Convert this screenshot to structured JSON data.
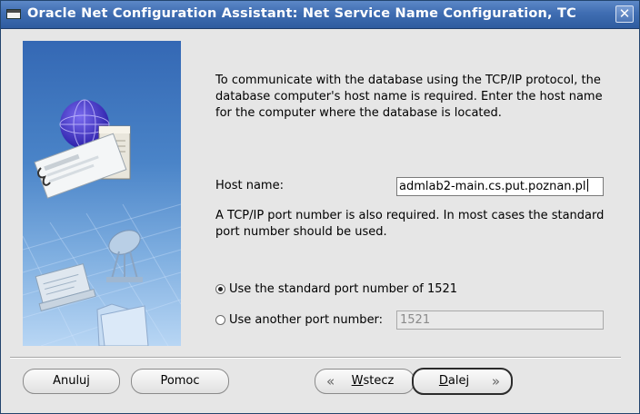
{
  "window": {
    "title": "Oracle Net Configuration Assistant: Net Service Name Configuration,  TC",
    "close_glyph": "✕"
  },
  "content": {
    "intro": "To communicate with the database using the TCP/IP protocol, the database computer's host name is required. Enter the host name for the computer where the database is located.",
    "host_label": "Host name:",
    "host_value": "admlab2-main.cs.put.poznan.pl",
    "port_note": "A TCP/IP port number is also required. In most cases the standard port number should be used.",
    "radio_standard_label": "Use the standard port number of 1521",
    "radio_another_label": "Use another port number:",
    "port_value": "1521",
    "selected_option": "standard"
  },
  "buttons": {
    "cancel": "Anuluj",
    "help": "Pomoc",
    "back": "Wstecz",
    "back_underline": "W",
    "back_rest": "stecz",
    "next": "Dalej",
    "next_underline": "D",
    "next_rest": "alej",
    "back_chevron": "«",
    "next_chevron": "»"
  },
  "icons": {
    "side_image": "network-illustration",
    "title_icon": "window-menu-icon"
  },
  "colors": {
    "titlebar": "#3f6db2",
    "panel_background": "#e6e6e6",
    "side_image_top": "#3468b4",
    "side_image_bottom": "#b8d6f4"
  }
}
